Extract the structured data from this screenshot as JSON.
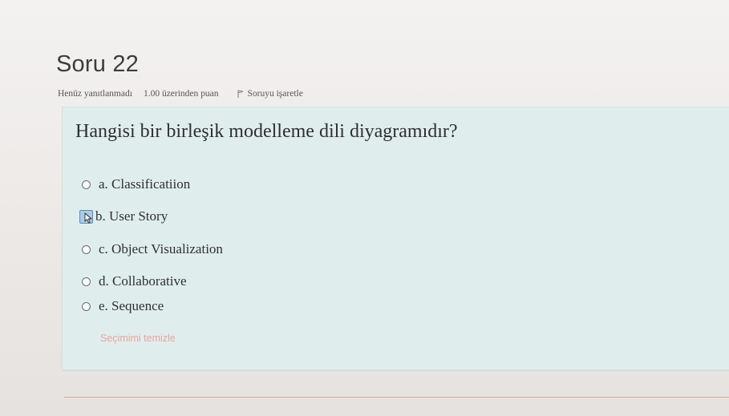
{
  "question": {
    "title": "Soru 22",
    "status": "Henüz yanıtlanmadı",
    "points": "1.00 üzerinden puan",
    "flag_label": "Soruyu işaretle",
    "text": "Hangisi bir birleşik modelleme dili diyagramıdır?",
    "options": [
      {
        "label": "a. Classificatiion"
      },
      {
        "label": "b. User Story"
      },
      {
        "label": "c. Object Visualization"
      },
      {
        "label": "d. Collaborative"
      },
      {
        "label": "e. Sequence"
      }
    ],
    "clear_choice": "Seçimimi temizle"
  },
  "colors": {
    "panel_background": "#dfeeed",
    "clear_link": "#e7a5a0",
    "hover_radio": "#a9cbe7"
  }
}
